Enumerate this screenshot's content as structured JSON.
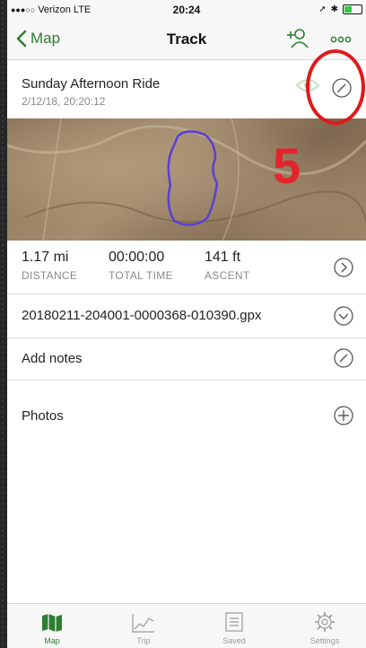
{
  "status_bar": {
    "carrier": "Verizon",
    "network": "LTE",
    "time": "20:24"
  },
  "nav": {
    "back_label": "Map",
    "title": "Track"
  },
  "track": {
    "name": "Sunday Afternoon Ride",
    "date": "2/12/18, 20:20:12"
  },
  "annotation": {
    "number": "5"
  },
  "stats": [
    {
      "value": "1.17 mi",
      "label": "DISTANCE"
    },
    {
      "value": "00:00:00",
      "label": "TOTAL TIME"
    },
    {
      "value": "141 ft",
      "label": "ASCENT"
    }
  ],
  "file_row": {
    "label": "20180211-204001-0000368-010390.gpx"
  },
  "notes_row": {
    "label": "Add notes"
  },
  "photos_row": {
    "label": "Photos"
  },
  "tabs": [
    {
      "label": "Map",
      "icon": "map-icon"
    },
    {
      "label": "Trip",
      "icon": "chart-icon"
    },
    {
      "label": "Saved",
      "icon": "saved-icon"
    },
    {
      "label": "Settings",
      "icon": "gear-icon"
    }
  ],
  "colors": {
    "accent": "#2e7d32",
    "track_line": "#5b3fd6",
    "annotation_red": "#e0191b"
  }
}
